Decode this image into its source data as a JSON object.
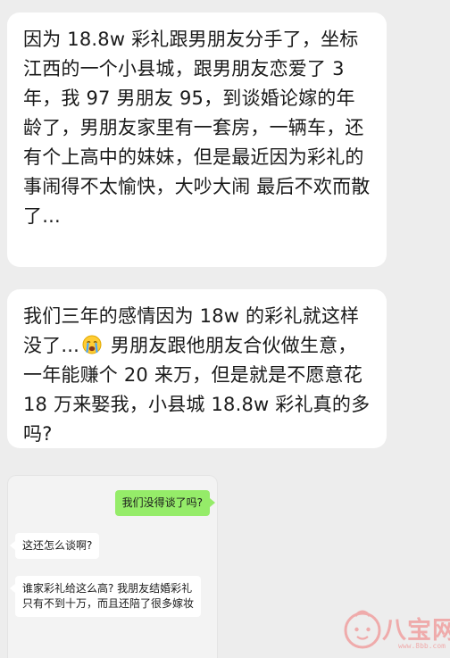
{
  "post_1": {
    "text": "因为 18.8w 彩礼跟男朋友分手了，坐标江西的一个小县城，跟男朋友恋爱了 3 年，我 97 男朋友 95，到谈婚论嫁的年龄了，男朋友家里有一套房，一辆车，还有个上高中的妹妹，但是最近因为彩礼的事闹得不太愉快，大吵大闹 最后不欢而散了..."
  },
  "post_2": {
    "text_before_emoji": "我们三年的感情因为 18w 的彩礼就这样没了...",
    "emoji": "crying-face-emoji",
    "text_after_emoji": " 男朋友跟他朋友合伙做生意，一年能赚个 20 来万，但是就是不愿意花 18 万来娶我，小县城 18.8w 彩礼真的多吗?"
  },
  "chat_screenshot": {
    "messages": [
      {
        "side": "right",
        "text": "我们没得谈了吗?"
      },
      {
        "side": "left",
        "text": "这还怎么谈啊?"
      },
      {
        "side": "left",
        "text": "谁家彩礼给这么高? 我朋友结婚彩礼只有不到十万，而且还陪了很多嫁妆"
      }
    ]
  },
  "watermark": {
    "text": "八宝网",
    "sub": "www.8bb.com",
    "icon": "baby-face-logo"
  },
  "colors": {
    "background": "#ededed",
    "bubble": "#ffffff",
    "sent_bubble": "#95ec69",
    "watermark": "#f0a0a0"
  }
}
